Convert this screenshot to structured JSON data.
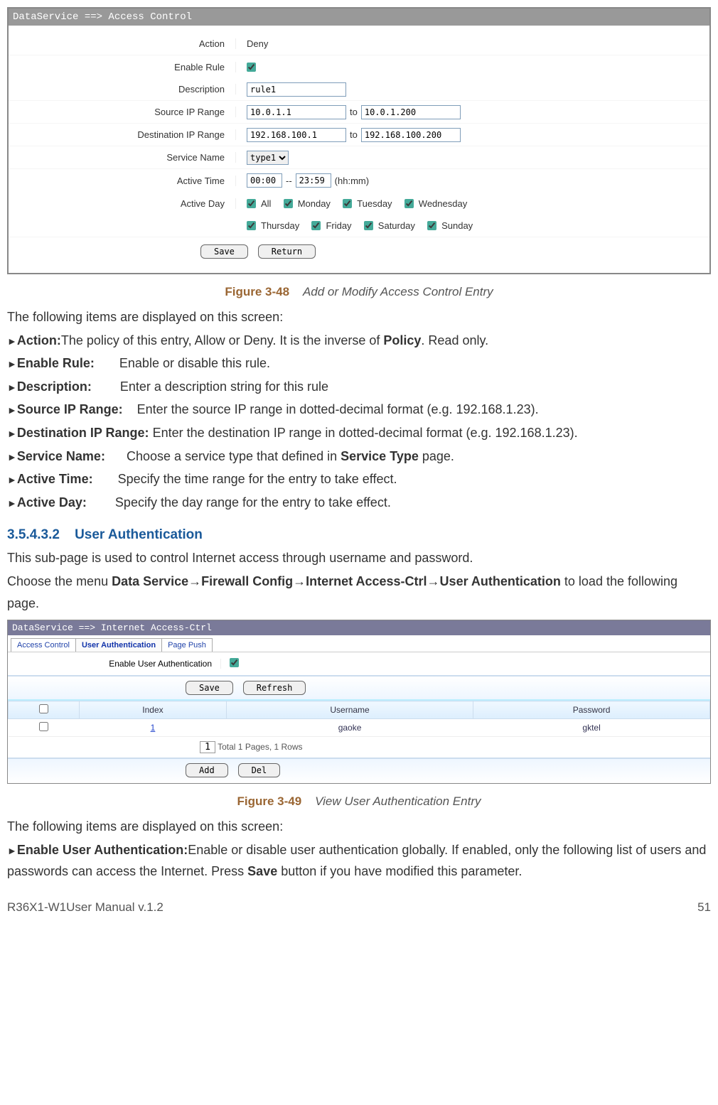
{
  "screenshot1": {
    "titlebar": "DataService ==> Access Control",
    "labels": {
      "action": "Action",
      "enable_rule": "Enable Rule",
      "description": "Description",
      "source_ip": "Source IP Range",
      "dest_ip": "Destination IP Range",
      "service_name": "Service Name",
      "active_time": "Active Time",
      "active_day": "Active Day"
    },
    "values": {
      "action": "Deny",
      "description": "rule1",
      "src_from": "10.0.1.1",
      "src_to": "10.0.1.200",
      "to_label": "to",
      "dst_from": "192.168.100.1",
      "dst_to": "192.168.100.200",
      "service_opt": "type1",
      "time_from": "00:00",
      "time_sep": "--",
      "time_to": "23:59",
      "time_hint": "(hh:mm)"
    },
    "days": [
      "All",
      "Monday",
      "Tuesday",
      "Wednesday",
      "Thursday",
      "Friday",
      "Saturday",
      "Sunday"
    ],
    "buttons": {
      "save": "Save",
      "return": "Return"
    }
  },
  "caption1": {
    "label": "Figure 3-48",
    "title": "Add or Modify Access Control Entry"
  },
  "text1": {
    "intro": "The following items are displayed on this screen:",
    "items": [
      {
        "term": "Action:",
        "desc": "The policy of this entry, Allow or Deny. It is the inverse of ",
        "bold_trail": "Policy",
        "tail": ". Read only."
      },
      {
        "term": "Enable Rule:",
        "desc": "Enable or disable this rule."
      },
      {
        "term": "Description:",
        "desc": "Enter a description string for this rule"
      },
      {
        "term": "Source IP Range:",
        "desc": "Enter the source IP range in dotted-decimal format (e.g. 192.168.1.23)."
      },
      {
        "term": "Destination IP Range:",
        "desc": "Enter the destination IP range in dotted-decimal format (e.g. 192.168.1.23)."
      },
      {
        "term": "Service Name:",
        "desc": "Choose a service type that defined in ",
        "bold_trail": "Service Type",
        "tail": " page."
      },
      {
        "term": "Active Time:",
        "desc": "Specify the time range for the entry to take effect."
      },
      {
        "term": "Active Day:",
        "desc": "Specify the day range for the entry to take effect."
      }
    ]
  },
  "heading": {
    "num": "3.5.4.3.2",
    "title": "User Authentication"
  },
  "text2": {
    "p1": "This sub-page is used to control Internet access through username and password.",
    "p2_pre": "Choose the menu ",
    "p2_bold": "Data Service→Firewall Config→Internet Access-Ctrl→User Authentication",
    "p2_post": " to load the following page."
  },
  "screenshot2": {
    "titlebar": "DataService ==> Internet Access-Ctrl",
    "tabs": [
      "Access Control",
      "User Authentication",
      "Page Push"
    ],
    "active_tab_index": 1,
    "enable_label": "Enable User Authentication",
    "buttons": {
      "save": "Save",
      "refresh": "Refresh",
      "add": "Add",
      "del": "Del"
    },
    "table": {
      "headers": [
        "",
        "Index",
        "Username",
        "Password"
      ],
      "row": {
        "index": "1",
        "username": "gaoke",
        "password": "gktel"
      }
    },
    "paging": {
      "page": "1",
      "info": "Total 1 Pages, 1 Rows"
    }
  },
  "caption2": {
    "label": "Figure 3-49",
    "title": "View User Authentication Entry"
  },
  "text3": {
    "intro": "The following items are displayed on this screen:",
    "term": "Enable User Authentication:",
    "desc_a": "Enable or disable user authentication globally. If enabled, only the following list of users and passwords can access the Internet. Press ",
    "desc_bold": "Save",
    "desc_b": " button if you have modified this parameter."
  },
  "footer": {
    "left": "R36X1-W1User Manual v.1.2",
    "right": "51"
  }
}
